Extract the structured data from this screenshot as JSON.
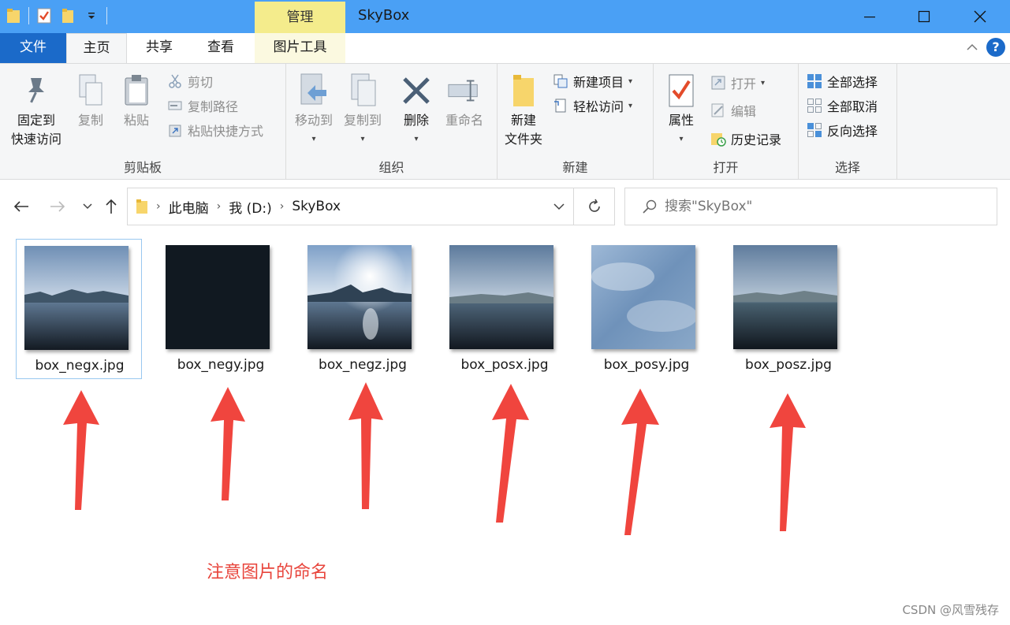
{
  "window": {
    "title": "SkyBox",
    "context_tab": "管理",
    "minimize_icon": "minimize-icon",
    "maximize_icon": "maximize-icon",
    "close_icon": "close-icon"
  },
  "tabs": {
    "file": "文件",
    "home": "主页",
    "share": "共享",
    "view": "查看",
    "picture_tools": "图片工具",
    "help": "?"
  },
  "ribbon": {
    "clipboard": {
      "label": "剪贴板",
      "pin_line1": "固定到",
      "pin_line2": "快速访问",
      "copy": "复制",
      "paste": "粘贴",
      "cut": "剪切",
      "copy_path": "复制路径",
      "paste_shortcut": "粘贴快捷方式"
    },
    "organize": {
      "label": "组织",
      "move_to": "移动到",
      "copy_to": "复制到",
      "delete": "删除",
      "rename": "重命名"
    },
    "new": {
      "label": "新建",
      "new_folder_line1": "新建",
      "new_folder_line2": "文件夹",
      "new_item": "新建项目",
      "easy_access": "轻松访问"
    },
    "open": {
      "label": "打开",
      "properties": "属性",
      "open": "打开",
      "edit": "编辑",
      "history": "历史记录"
    },
    "select": {
      "label": "选择",
      "select_all": "全部选择",
      "select_none": "全部取消",
      "invert": "反向选择"
    }
  },
  "address": {
    "crumbs": [
      "此电脑",
      "我 (D:)",
      "SkyBox"
    ],
    "search_placeholder": "搜索\"SkyBox\""
  },
  "files": [
    {
      "name": "box_negx.jpg",
      "selected": true
    },
    {
      "name": "box_negy.jpg",
      "selected": false
    },
    {
      "name": "box_negz.jpg",
      "selected": false
    },
    {
      "name": "box_posx.jpg",
      "selected": false
    },
    {
      "name": "box_posy.jpg",
      "selected": false
    },
    {
      "name": "box_posz.jpg",
      "selected": false
    }
  ],
  "annotation": {
    "note": "注意图片的命名",
    "arrow_color": "#f0453e",
    "credit": "CSDN @风雪残存"
  },
  "colors": {
    "titlebar": "#4aa0f5",
    "file_tab": "#1b6ac9",
    "manage_tab": "#f4ec8c"
  }
}
